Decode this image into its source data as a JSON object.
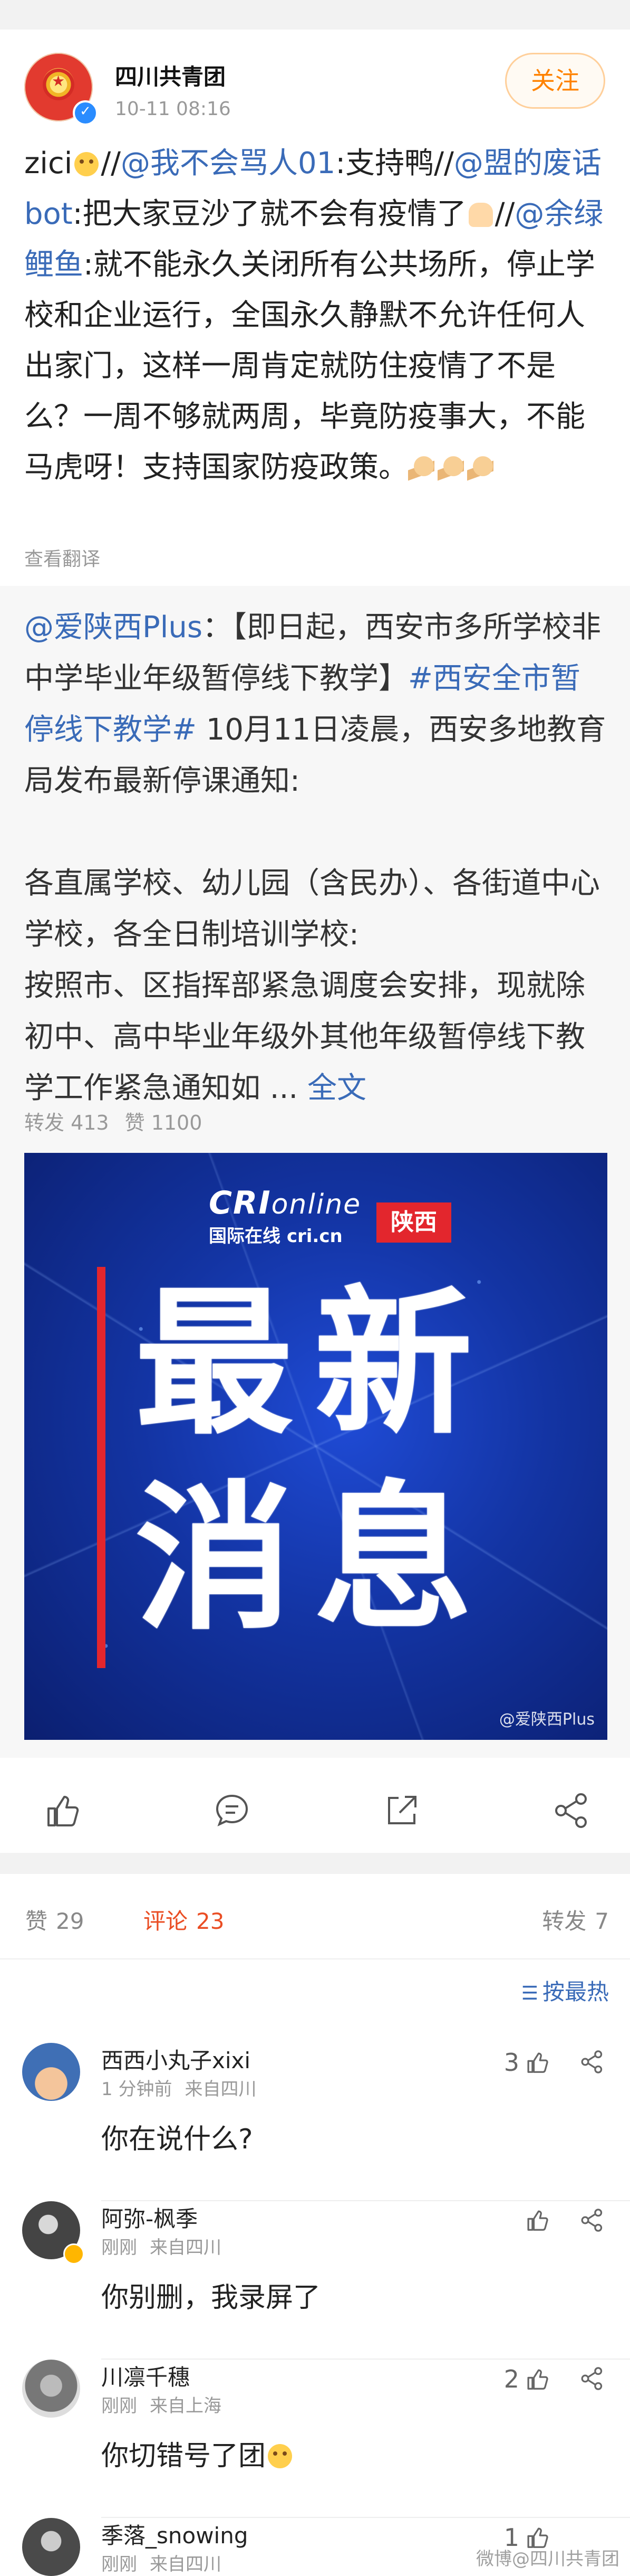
{
  "post": {
    "author": "四川共青团",
    "time": "10-11 08:16",
    "follow_label": "关注",
    "text": {
      "p0": "zici",
      "p1": "//",
      "m1": "@我不会骂人01",
      "p2": ":支持鸭//",
      "m2": "@盟的废话bot",
      "p3": ":把大家豆沙了就不会有疫情了",
      "p4": "//",
      "m3": "@余绿鲤鱼",
      "p5": ":就不能永久关闭所有公共场所，停止学校和企业运行，全国永久静默不允许任何人出家门，这样一周肯定就防住疫情了不是么？一周不够就两周，毕竟防疫事大，不能马虎呀！支持国家防疫政策。"
    },
    "see_translation": "查看翻译"
  },
  "repost": {
    "author_mention": "@爱陕西Plus",
    "line1": "：【即日起，西安市多所学校非中学毕业年级暂停线下教学】",
    "hashtag": "#西安全市暂停线下教学#",
    "line2": " 10月11日凌晨，西安多地教育局发布最新停课通知:",
    "para2": "各直属学校、幼儿园（含民办）、各街道中心学校，各全日制培训学校:",
    "para3": "按照市、区指挥部紧急调度会安排，现就除初中、高中毕业年级外其他年级暂停线下教学工作紧急通知如",
    "ellipsis": " ... ",
    "full_text_link": "全文",
    "reposts": "转发 413",
    "likes": "赞 1100",
    "image": {
      "brand": "CRI",
      "brand_online": "online",
      "brand_sub": "国际在线 cri.cn",
      "region_badge": "陕西",
      "headline_line1": "最新",
      "headline_line2": "消息",
      "watermark": "@爱陕西Plus"
    }
  },
  "stats": {
    "likes_label": "赞",
    "likes_count": "29",
    "comments_label": "评论",
    "comments_count": "23",
    "reposts_label": "转发",
    "reposts_count": "7"
  },
  "sort_label": "按最热",
  "comments": [
    {
      "name": "西西小丸子xixi",
      "time": "1 分钟前",
      "location": "来自四川",
      "text": "你在说什么?",
      "likes": "3",
      "avatar_color": "#3f6fb5"
    },
    {
      "name": "阿弥-枫季",
      "time": "刚刚",
      "location": "来自四川",
      "text": "你别删，我录屏了",
      "likes": "",
      "avatar_color": "#5a5a5a"
    },
    {
      "name": "川凛千穗",
      "time": "刚刚",
      "location": "来自上海",
      "text": "你切错号了团",
      "likes": "2",
      "avatar_color": "#8a8a8a"
    },
    {
      "name": "季落_snowing",
      "time": "刚刚",
      "location": "来自四川",
      "text": "",
      "likes": "1",
      "avatar_color": "#4a4a4a"
    }
  ],
  "page_watermark": "微博@四川共青团"
}
